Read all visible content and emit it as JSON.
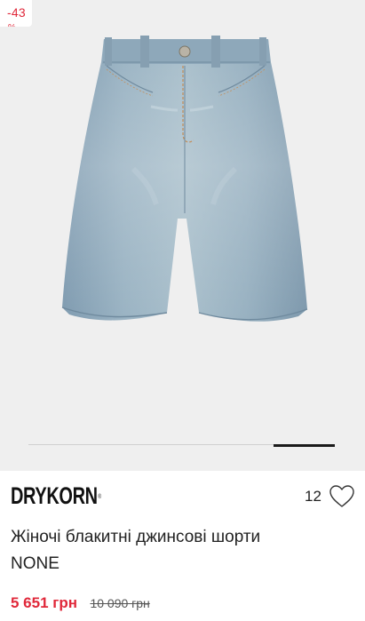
{
  "badge": {
    "discount": "-43",
    "discount_suffix": "%"
  },
  "gallery": {
    "slides_total": 5,
    "active_slide": 5
  },
  "product": {
    "brand": "DRYKORN",
    "brand_mark": "®",
    "likes": "12",
    "title_line1": "Жіночі блакитні джинсові шорти",
    "title_line2": "NONE",
    "price_current": "5 651 грн",
    "price_old": "10 090 грн"
  },
  "colors": {
    "sale_red": "#e0283a",
    "text_dark": "#222222",
    "image_bg": "#efefef",
    "denim": "#8fa9bb"
  },
  "icons": {
    "favorite": "heart-outline-icon"
  }
}
